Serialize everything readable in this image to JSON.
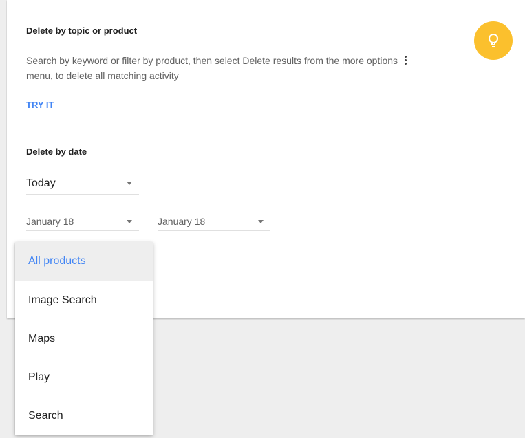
{
  "topic_section": {
    "title": "Delete by topic or product",
    "desc_part1": "Search by keyword or filter by product, then select Delete results from the more options",
    "desc_part2": "menu, to delete all matching activity",
    "try_it_label": "TRY IT",
    "icon": "lightbulb-icon"
  },
  "date_section": {
    "title": "Delete by date",
    "range_select": {
      "value": "Today"
    },
    "start_date": {
      "value": "January 18"
    },
    "end_date": {
      "value": "January 18"
    }
  },
  "product_menu": {
    "items": [
      {
        "label": "All products",
        "selected": true
      },
      {
        "label": "Image Search"
      },
      {
        "label": "Maps"
      },
      {
        "label": "Play"
      },
      {
        "label": "Search"
      }
    ]
  },
  "colors": {
    "accent": "#4285f4",
    "bulb": "#fbc02d",
    "background": "#eeeeee"
  }
}
